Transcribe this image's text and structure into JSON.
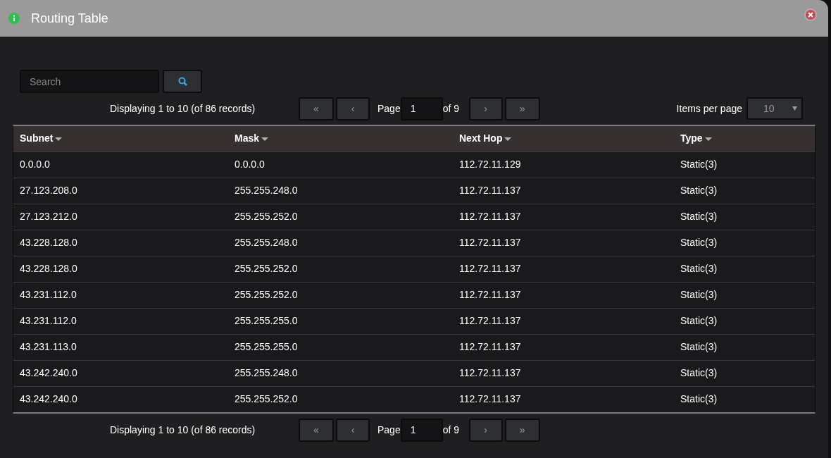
{
  "window": {
    "title": "Routing Table"
  },
  "search": {
    "placeholder": "Search"
  },
  "pager_top": {
    "summary": "Displaying 1 to 10 (of 86 records)",
    "first": "«",
    "prev": "‹",
    "page_label": "Page",
    "page": "1",
    "of": "of 9",
    "next": "›",
    "last": "»",
    "items_per_page_label": "Items per page",
    "items_per_page": "10"
  },
  "table": {
    "columns": [
      "Subnet",
      "Mask",
      "Next Hop",
      "Type"
    ],
    "rows": [
      [
        "0.0.0.0",
        "0.0.0.0",
        "112.72.11.129",
        "Static(3)"
      ],
      [
        "27.123.208.0",
        "255.255.248.0",
        "112.72.11.137",
        "Static(3)"
      ],
      [
        "27.123.212.0",
        "255.255.252.0",
        "112.72.11.137",
        "Static(3)"
      ],
      [
        "43.228.128.0",
        "255.255.248.0",
        "112.72.11.137",
        "Static(3)"
      ],
      [
        "43.228.128.0",
        "255.255.252.0",
        "112.72.11.137",
        "Static(3)"
      ],
      [
        "43.231.112.0",
        "255.255.252.0",
        "112.72.11.137",
        "Static(3)"
      ],
      [
        "43.231.112.0",
        "255.255.255.0",
        "112.72.11.137",
        "Static(3)"
      ],
      [
        "43.231.113.0",
        "255.255.255.0",
        "112.72.11.137",
        "Static(3)"
      ],
      [
        "43.242.240.0",
        "255.255.248.0",
        "112.72.11.137",
        "Static(3)"
      ],
      [
        "43.242.240.0",
        "255.255.252.0",
        "112.72.11.137",
        "Static(3)"
      ]
    ]
  },
  "pager_bottom": {
    "summary": "Displaying 1 to 10 (of 86 records)",
    "first": "«",
    "prev": "‹",
    "page_label": "Page",
    "page": "1",
    "of": "of 9",
    "next": "›",
    "last": "»"
  }
}
